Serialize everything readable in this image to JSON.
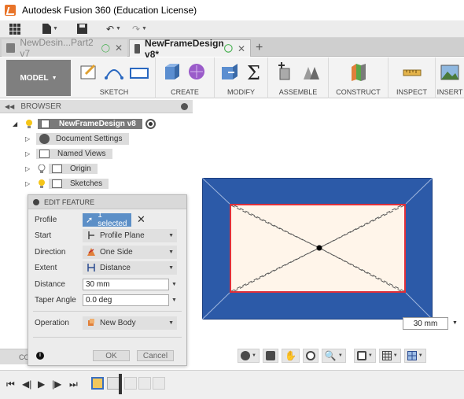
{
  "window": {
    "title": "Autodesk Fusion 360 (Education License)"
  },
  "tabs": [
    {
      "label": "NewDesin...Part2 v7",
      "active": false
    },
    {
      "label": "NewFrameDesign v8*",
      "active": true
    }
  ],
  "toolbar": {
    "workspace": "MODEL",
    "groups": [
      "SKETCH",
      "CREATE",
      "MODIFY",
      "ASSEMBLE",
      "CONSTRUCT",
      "INSPECT",
      "INSERT"
    ]
  },
  "browser": {
    "title": "BROWSER",
    "root": "NewFrameDesign v8",
    "items": [
      "Document Settings",
      "Named Views",
      "Origin",
      "Sketches"
    ]
  },
  "edit_feature": {
    "title": "EDIT FEATURE",
    "profile_label": "Profile",
    "profile_value": "1 selected",
    "start_label": "Start",
    "start_value": "Profile Plane",
    "direction_label": "Direction",
    "direction_value": "One Side",
    "extent_label": "Extent",
    "extent_value": "Distance",
    "distance_label": "Distance",
    "distance_value": "30 mm",
    "taper_label": "Taper Angle",
    "taper_value": "0.0 deg",
    "operation_label": "Operation",
    "operation_value": "New Body",
    "ok": "OK",
    "cancel": "Cancel"
  },
  "comments_label": "CO",
  "viewport": {
    "dimension_value": "30 mm",
    "colors": {
      "body": "#2c5aa8",
      "profile_fill": "#fff5ea",
      "profile_edge": "#e0303a"
    }
  }
}
